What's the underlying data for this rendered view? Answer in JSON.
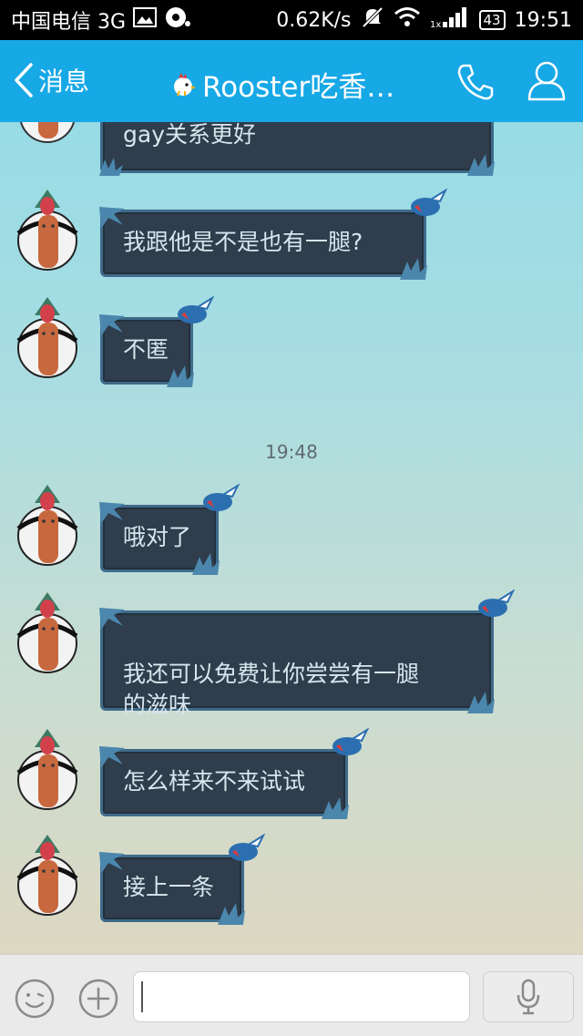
{
  "status_bar": {
    "carrier": "中国电信 3G",
    "speed": "0.62K/s",
    "battery": "43",
    "time": "19:51"
  },
  "header": {
    "back_label": "消息",
    "title": "Rooster吃香…"
  },
  "messages": [
    {
      "text": "gay关系更好"
    },
    {
      "text": "我跟他是不是也有一腿?"
    },
    {
      "text": "不匿"
    },
    {
      "text": "哦对了"
    },
    {
      "text": "我还可以免费让你尝尝有一腿\n的滋味"
    },
    {
      "text": "怎么样来不来试试"
    },
    {
      "text": "接上一条"
    }
  ],
  "timestamp": "19:48",
  "input": {
    "placeholder": ""
  },
  "colors": {
    "header": "#17a8e6",
    "bubble": "#2f3d4c",
    "bubble_border": "#3f6a8a"
  }
}
